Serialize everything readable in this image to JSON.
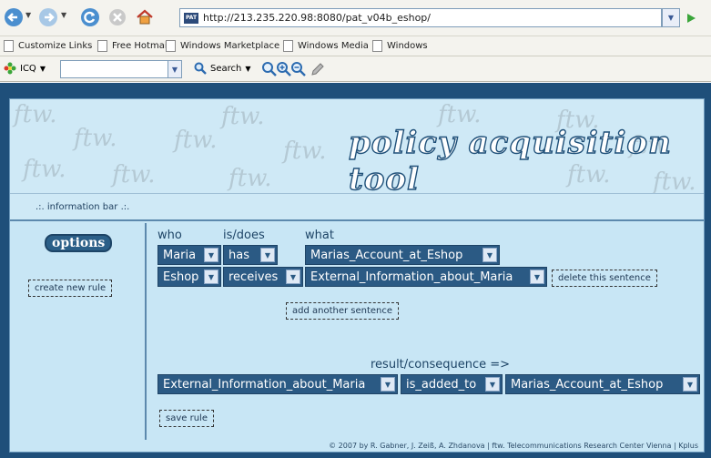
{
  "browser": {
    "url": "http://213.235.220.98:8080/pat_v04b_eshop/",
    "favicon_text": "PAT",
    "links": [
      "Customize Links",
      "Free Hotmail",
      "Windows Marketplace",
      "Windows Media",
      "Windows"
    ],
    "icq_label": "ICQ",
    "search_label": "Search",
    "icons": {
      "back": "arrow-left-icon",
      "forward": "arrow-right-icon",
      "refresh": "refresh-icon",
      "stop": "stop-icon",
      "home": "home-icon",
      "go": "go-arrow-icon"
    }
  },
  "app": {
    "title": "policy acquisition tool",
    "watermark": "ftw.",
    "info_bar": ".:. information bar .:.",
    "options_title": "options",
    "create_new_rule": "create new rule",
    "columns": {
      "who": "who",
      "isdoes": "is/does",
      "what": "what"
    },
    "sentences": [
      {
        "who": "Maria",
        "verb": "has",
        "what": "Marias_Account_at_Eshop"
      },
      {
        "who": "Eshop",
        "verb": "receives",
        "what": "External_Information_about_Maria"
      }
    ],
    "delete_sentence": "delete this sentence",
    "add_sentence": "add another sentence",
    "result_label": "result/consequence =>",
    "result": {
      "subject": "External_Information_about_Maria",
      "verb": "is_added_to",
      "object": "Marias_Account_at_Eshop"
    },
    "save_rule": "save rule",
    "footer": "© 2007 by R. Gabner, J. Zeiß, A. Zhdanova | ftw. Telecommunications Research Center Vienna | Kplus"
  },
  "colors": {
    "page_background": "#1f4f7a",
    "panel": "#c8e6f5",
    "select_fill": "#2b5a84"
  }
}
